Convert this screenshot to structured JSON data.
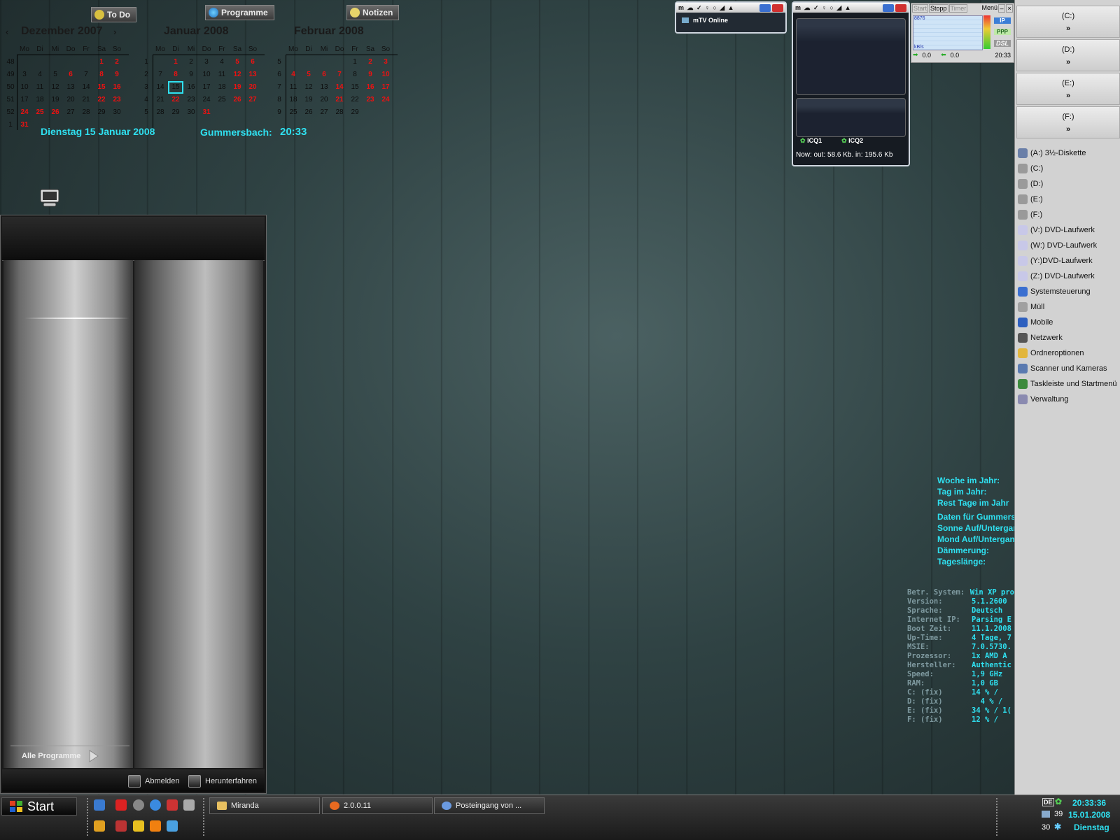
{
  "top_buttons": {
    "todo": "To Do",
    "programme": "Programme",
    "notizen": "Notizen"
  },
  "calendars": [
    {
      "title": "Dezember 2007",
      "nav_prev": "‹",
      "nav_next": "›",
      "weekdays": [
        "Mo",
        "Di",
        "Mi",
        "Do",
        "Fr",
        "Sa",
        "So"
      ],
      "rows": [
        {
          "wk": "48",
          "days": [
            "",
            "",
            "",
            "",
            "",
            "1",
            "2"
          ]
        },
        {
          "wk": "49",
          "days": [
            "3",
            "4",
            "5",
            "6",
            "7",
            "8",
            "9"
          ]
        },
        {
          "wk": "50",
          "days": [
            "10",
            "11",
            "12",
            "13",
            "14",
            "15",
            "16"
          ]
        },
        {
          "wk": "51",
          "days": [
            "17",
            "18",
            "19",
            "20",
            "21",
            "22",
            "23"
          ]
        },
        {
          "wk": "52",
          "days": [
            "24",
            "25",
            "26",
            "27",
            "28",
            "29",
            "30"
          ]
        },
        {
          "wk": "1",
          "days": [
            "31",
            "",
            "",
            "",
            "",
            "",
            ""
          ]
        }
      ]
    },
    {
      "title": "Januar 2008",
      "weekdays": [
        "Mo",
        "Di",
        "Mi",
        "Do",
        "Fr",
        "Sa",
        "So"
      ],
      "rows": [
        {
          "wk": "1",
          "days": [
            "",
            "1",
            "2",
            "3",
            "4",
            "5",
            "6"
          ]
        },
        {
          "wk": "2",
          "days": [
            "7",
            "8",
            "9",
            "10",
            "11",
            "12",
            "13"
          ]
        },
        {
          "wk": "3",
          "days": [
            "14",
            "15",
            "16",
            "17",
            "18",
            "19",
            "20"
          ]
        },
        {
          "wk": "4",
          "days": [
            "21",
            "22",
            "23",
            "24",
            "25",
            "26",
            "27"
          ]
        },
        {
          "wk": "5",
          "days": [
            "28",
            "29",
            "30",
            "31",
            "",
            "",
            ""
          ]
        }
      ]
    },
    {
      "title": "Februar 2008",
      "weekdays": [
        "Mo",
        "Di",
        "Mi",
        "Do",
        "Fr",
        "Sa",
        "So"
      ],
      "rows": [
        {
          "wk": "5",
          "days": [
            "",
            "",
            "",
            "",
            "1",
            "2",
            "3"
          ]
        },
        {
          "wk": "6",
          "days": [
            "4",
            "5",
            "6",
            "7",
            "8",
            "9",
            "10"
          ]
        },
        {
          "wk": "7",
          "days": [
            "11",
            "12",
            "13",
            "14",
            "15",
            "16",
            "17"
          ]
        },
        {
          "wk": "8",
          "days": [
            "18",
            "19",
            "20",
            "21",
            "22",
            "23",
            "24"
          ]
        },
        {
          "wk": "9",
          "days": [
            "25",
            "26",
            "27",
            "28",
            "29",
            "",
            ""
          ]
        }
      ]
    }
  ],
  "date_line": "Dienstag 15  Januar 2008",
  "location_time": {
    "label": "Gummersbach:",
    "time": "20:33"
  },
  "start_menu": {
    "all_programs": "Alle Programme",
    "logoff": "Abmelden",
    "shutdown": "Herunterfahren"
  },
  "mtv_widget": {
    "status": "mTV Online"
  },
  "icq_widget": {
    "icq1": "ICQ1",
    "icq2": "ICQ2",
    "traffic": "Now: out: 58.6 Kb.  in: 195.6 Kb"
  },
  "dsl_widget": {
    "start": "Start",
    "stopp": "Stopp",
    "timer": "Timer",
    "menu": "Menü",
    "top_left": "8876",
    "unit": "kB/s",
    "ip": "IP",
    "ppp": "PPP",
    "dsl": "DSL",
    "out_val": "0.0",
    "in_val": "0.0",
    "time": "20:33"
  },
  "sidebar": {
    "drives": [
      {
        "label": "(C:)",
        "arrow": "»"
      },
      {
        "label": "(D:)",
        "arrow": "»"
      },
      {
        "label": "(E:)",
        "arrow": "»"
      },
      {
        "label": "(F:)",
        "arrow": "»"
      }
    ],
    "items": [
      {
        "label": "(A:) 3½-Diskette",
        "icon": "floppy-icon",
        "color": "#6a7fa8"
      },
      {
        "label": "(C:)",
        "icon": "harddisk-icon",
        "color": "#9a9a9a"
      },
      {
        "label": "(D:)",
        "icon": "harddisk-icon",
        "color": "#9a9a9a"
      },
      {
        "label": "(E:)",
        "icon": "harddisk-icon",
        "color": "#9a9a9a"
      },
      {
        "label": "(F:)",
        "icon": "harddisk-icon",
        "color": "#9a9a9a"
      },
      {
        "label": "(V:) DVD-Laufwerk",
        "icon": "dvd-icon",
        "color": "#c8c8e8"
      },
      {
        "label": "(W:) DVD-Laufwerk",
        "icon": "dvd-icon",
        "color": "#c8c8e8"
      },
      {
        "label": "(Y:)DVD-Laufwerk",
        "icon": "dvd-icon",
        "color": "#c8c8e8"
      },
      {
        "label": "(Z:) DVD-Laufwerk",
        "icon": "dvd-icon",
        "color": "#c8c8e8"
      },
      {
        "label": "Systemsteuerung",
        "icon": "control-panel-icon",
        "color": "#3a6fd0"
      },
      {
        "label": "Müll",
        "icon": "recycle-bin-icon",
        "color": "#a0a0a0"
      },
      {
        "label": "Mobile",
        "icon": "mobile-icon",
        "color": "#2d5fbf"
      },
      {
        "label": "Netzwerk",
        "icon": "network-icon",
        "color": "#555"
      },
      {
        "label": "Ordneroptionen",
        "icon": "folder-options-icon",
        "color": "#e2b63c"
      },
      {
        "label": "Scanner und Kameras",
        "icon": "scanner-icon",
        "color": "#5a7ab0"
      },
      {
        "label": "Taskleiste und Startmenü",
        "icon": "taskbar-icon",
        "color": "#3c8a3c"
      },
      {
        "label": "Verwaltung",
        "icon": "admin-tools-icon",
        "color": "#8a8ab0"
      }
    ]
  },
  "year_info": {
    "lines1": [
      "Woche im Jahr:",
      "Tag im Jahr:",
      "Rest Tage im Jahr"
    ],
    "lines2": [
      "Daten für Gummersbach",
      "Sonne Auf/Untergang",
      "Mond Auf/Untergang",
      "Dämmerung:",
      "Tageslänge:"
    ]
  },
  "system_info": [
    {
      "k": "Betr. System:",
      "v": "Win XP pro"
    },
    {
      "k": "Version:",
      "v": "5.1.2600"
    },
    {
      "k": "Sprache:",
      "v": "Deutsch"
    },
    {
      "k": "Internet IP:",
      "v": "Parsing E"
    },
    {
      "k": "Boot Zeit:",
      "v": "11.1.2008"
    },
    {
      "k": "Up-Time:",
      "v": "4 Tage, 7"
    },
    {
      "k": "MSIE:",
      "v": "7.0.5730."
    },
    {
      "k": "Prozessor:",
      "v": "1x AMD A"
    },
    {
      "k": "Hersteller:",
      "v": "Authentic"
    },
    {
      "k": "Speed:",
      "v": "1,9 GHz"
    },
    {
      "k": "RAM:",
      "v": "1,0 GB"
    },
    {
      "k": "C: (fix)",
      "v": "14 % /"
    },
    {
      "k": "D: (fix)",
      "v": "  4 % /"
    },
    {
      "k": "E: (fix)",
      "v": "34 % / 1("
    },
    {
      "k": "F: (fix)",
      "v": "12 % /"
    }
  ],
  "taskbar": {
    "start": "Start",
    "tasks": [
      {
        "label": "Miranda",
        "icon": "folder-icon"
      },
      {
        "label": "2.0.0.11",
        "icon": "firefox-icon"
      },
      {
        "label": "Posteingang von ...",
        "icon": "mail-icon"
      }
    ],
    "tray": {
      "time": "20:33:36",
      "date": "15.01.2008",
      "day": "Dienstag",
      "n1": "39",
      "n2": "30",
      "kb": "DE"
    }
  }
}
